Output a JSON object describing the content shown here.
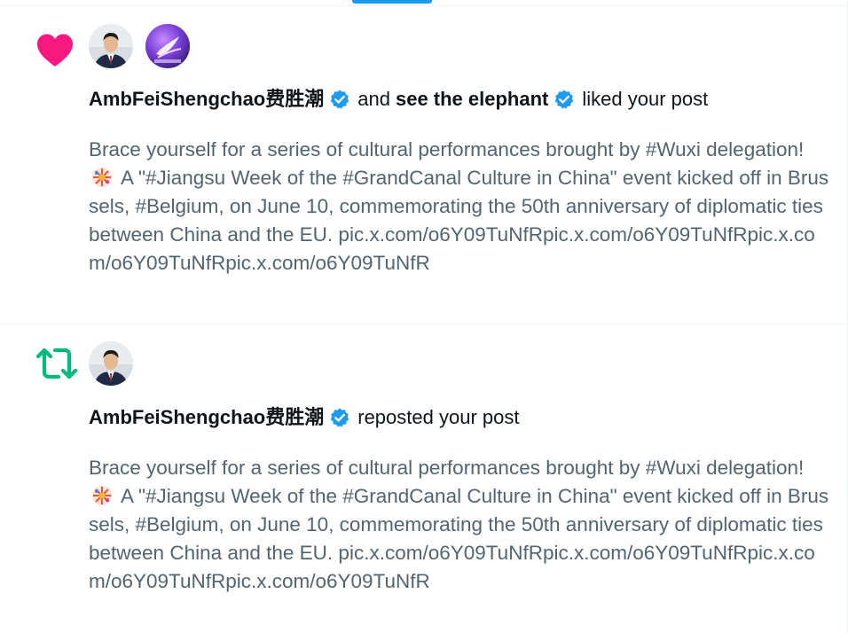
{
  "colors": {
    "like": "#f91880",
    "repost": "#00ba7c",
    "verified": "#1d9bf0",
    "secondary_text": "#536471",
    "primary_text": "#0f1419"
  },
  "notifications": [
    {
      "type": "like",
      "icon": "heart-icon",
      "actor_1": "AmbFeiShengchao费胜潮",
      "joiner": "and",
      "actor_2": "see the elephant",
      "verb": "liked your post",
      "post_before_emoji": "Brace yourself for a series of cultural performances brought by #Wuxi delegation!",
      "emoji": "sparkler-emoji",
      "post_after_emoji": "A \"#Jiangsu Week of the #GrandCanal Culture in China\" event kicked off in Brussels, #Belgium, on June 10, commemorating the 50th anniversary of diplomatic ties between China and the EU. pic.x.com/o6Y09TuNfRpic.x.com/o6Y09TuNfRpic.x.com/o6Y09TuNfRpic.x.com/o6Y09TuNfR"
    },
    {
      "type": "repost",
      "icon": "repost-icon",
      "actor_1": "AmbFeiShengchao费胜潮",
      "verb": "reposted your post",
      "post_before_emoji": "Brace yourself for a series of cultural performances brought by #Wuxi delegation!",
      "emoji": "sparkler-emoji",
      "post_after_emoji": "A \"#Jiangsu Week of the #GrandCanal Culture in China\" event kicked off in Brussels, #Belgium, on June 10, commemorating the 50th anniversary of diplomatic ties between China and the EU. pic.x.com/o6Y09TuNfRpic.x.com/o6Y09TuNfRpic.x.com/o6Y09TuNfRpic.x.com/o6Y09TuNfR"
    }
  ]
}
